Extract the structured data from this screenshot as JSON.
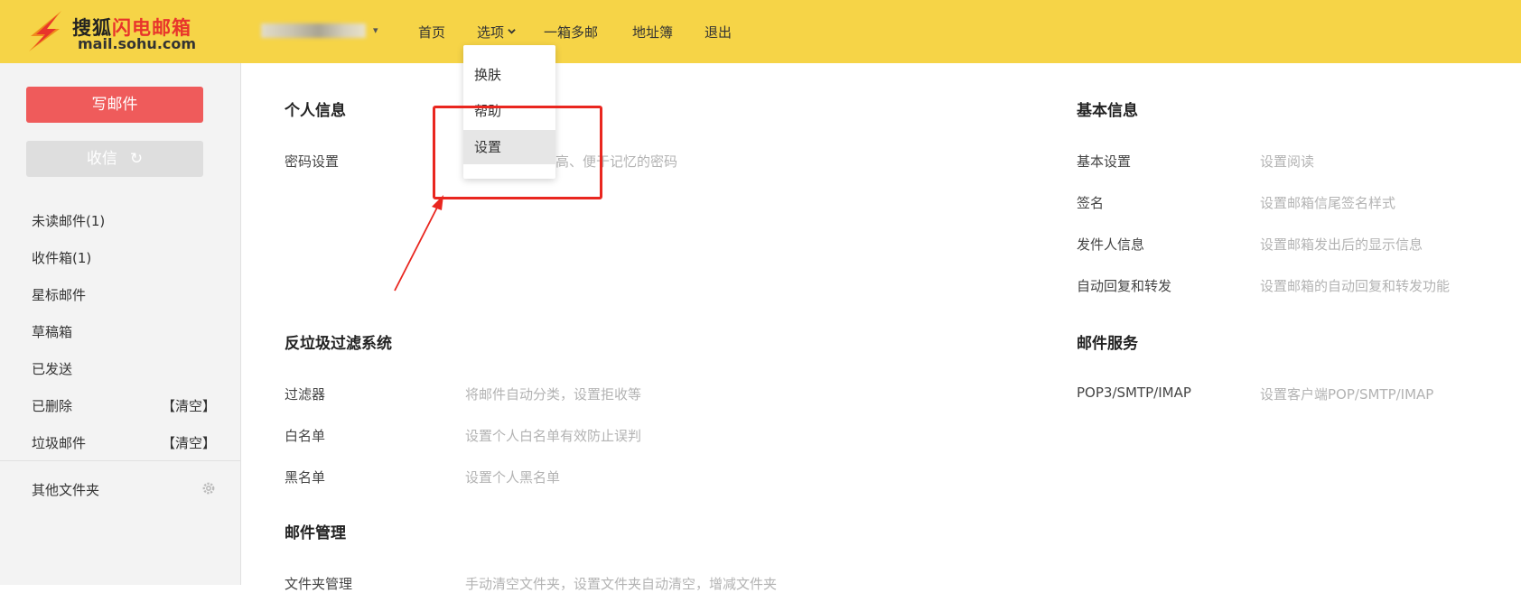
{
  "brand": {
    "name_black": "搜狐",
    "name_red": "闪电邮箱",
    "domain": "mail.sohu.com"
  },
  "topnav": [
    "首页",
    "选项",
    "一箱多邮",
    "地址簿",
    "退出"
  ],
  "dropdown": {
    "items": [
      "换肤",
      "帮助",
      "设置"
    ],
    "selected": "设置"
  },
  "sidebar": {
    "write_label": "写邮件",
    "receive_label": "收信",
    "folders": [
      {
        "label": "未读邮件(1)",
        "action": ""
      },
      {
        "label": "收件箱(1)",
        "action": ""
      },
      {
        "label": "星标邮件",
        "action": ""
      },
      {
        "label": "草稿箱",
        "action": ""
      },
      {
        "label": "已发送",
        "action": ""
      },
      {
        "label": "已删除",
        "action": "【清空】"
      },
      {
        "label": "垃圾邮件",
        "action": "【清空】"
      }
    ],
    "other_folders": "其他文件夹"
  },
  "sections": {
    "personal": {
      "title": "个人信息",
      "items": [
        {
          "label": "密码设置",
          "desc": "高、便于记忆的密码"
        }
      ]
    },
    "spam": {
      "title": "反垃圾过滤系统",
      "items": [
        {
          "label": "过滤器",
          "desc": "将邮件自动分类，设置拒收等"
        },
        {
          "label": "白名单",
          "desc": "设置个人白名单有效防止误判"
        },
        {
          "label": "黑名单",
          "desc": "设置个人黑名单"
        }
      ]
    },
    "manage": {
      "title": "邮件管理",
      "items": [
        {
          "label": "文件夹管理",
          "desc": "手动清空文件夹，设置文件夹自动清空，增减文件夹"
        }
      ]
    },
    "basic": {
      "title": "基本信息",
      "items": [
        {
          "label": "基本设置",
          "desc": "设置阅读"
        },
        {
          "label": "签名",
          "desc": "设置邮箱信尾签名样式"
        },
        {
          "label": "发件人信息",
          "desc": "设置邮箱发出后的显示信息"
        },
        {
          "label": "自动回复和转发",
          "desc": "设置邮箱的自动回复和转发功能"
        }
      ]
    },
    "service": {
      "title": "邮件服务",
      "items": [
        {
          "label": "POP3/SMTP/IMAP",
          "desc": "设置客户端POP/SMTP/IMAP"
        }
      ]
    }
  },
  "colors": {
    "topbar": "#f6d447",
    "write_button": "#ef5b5b",
    "highlight": "#e9261f"
  }
}
